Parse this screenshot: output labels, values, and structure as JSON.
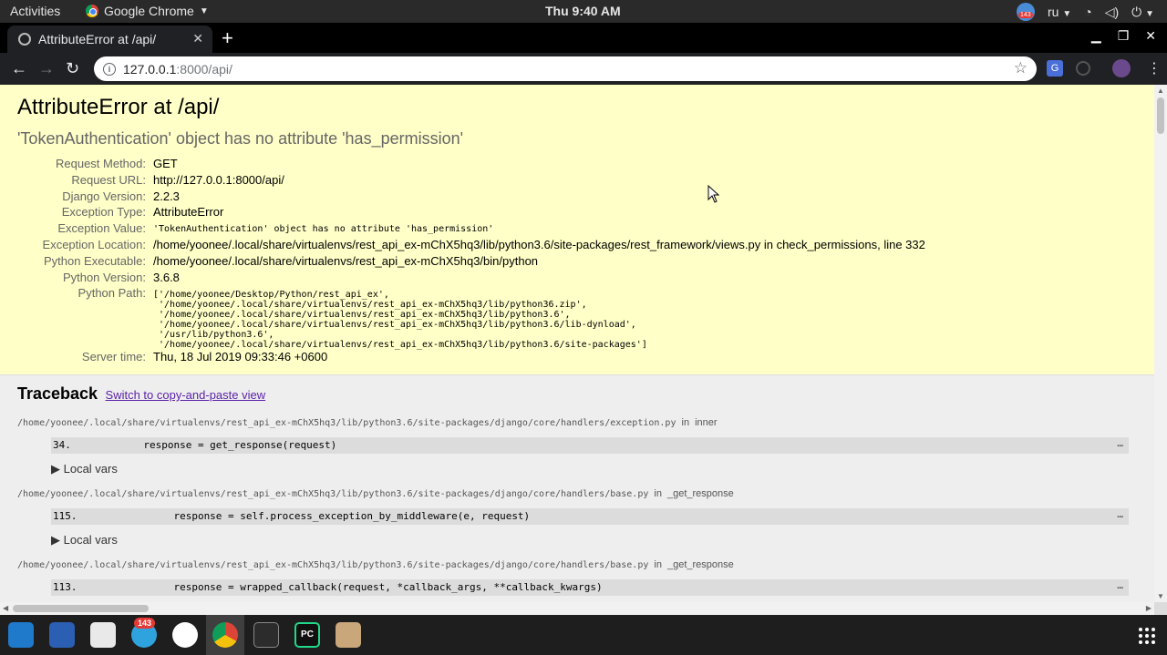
{
  "topbar": {
    "activities": "Activities",
    "app_name": "Google Chrome",
    "clock": "Thu  9:40 AM",
    "lang": "ru",
    "tray_badge": "143"
  },
  "tab": {
    "title": "AttributeError at /api/"
  },
  "omnibox": {
    "host": "127.0.0.1",
    "path": ":8000/api/"
  },
  "extensions": {
    "translate_label": "G"
  },
  "page": {
    "title": "AttributeError at /api/",
    "subtitle": "'TokenAuthentication' object has no attribute 'has_permission'",
    "meta": {
      "request_method": {
        "label": "Request Method:",
        "value": "GET"
      },
      "request_url": {
        "label": "Request URL:",
        "value": "http://127.0.0.1:8000/api/"
      },
      "django_version": {
        "label": "Django Version:",
        "value": "2.2.3"
      },
      "exception_type": {
        "label": "Exception Type:",
        "value": "AttributeError"
      },
      "exception_value": {
        "label": "Exception Value:",
        "value": "'TokenAuthentication' object has no attribute 'has_permission'"
      },
      "exception_location": {
        "label": "Exception Location:",
        "value": "/home/yoonee/.local/share/virtualenvs/rest_api_ex-mChX5hq3/lib/python3.6/site-packages/rest_framework/views.py in check_permissions, line 332"
      },
      "python_executable": {
        "label": "Python Executable:",
        "value": "/home/yoonee/.local/share/virtualenvs/rest_api_ex-mChX5hq3/bin/python"
      },
      "python_version": {
        "label": "Python Version:",
        "value": "3.6.8"
      },
      "python_path": {
        "label": "Python Path:",
        "value": "['/home/yoonee/Desktop/Python/rest_api_ex',\n '/home/yoonee/.local/share/virtualenvs/rest_api_ex-mChX5hq3/lib/python36.zip',\n '/home/yoonee/.local/share/virtualenvs/rest_api_ex-mChX5hq3/lib/python3.6',\n '/home/yoonee/.local/share/virtualenvs/rest_api_ex-mChX5hq3/lib/python3.6/lib-dynload',\n '/usr/lib/python3.6',\n '/home/yoonee/.local/share/virtualenvs/rest_api_ex-mChX5hq3/lib/python3.6/site-packages']"
      },
      "server_time": {
        "label": "Server time:",
        "value": "Thu, 18 Jul 2019 09:33:46 +0600"
      }
    }
  },
  "traceback": {
    "heading": "Traceback",
    "switch_link": "Switch to copy-and-paste view",
    "in_word": "in",
    "ellipsis": "…",
    "local_vars": "▶ Local vars",
    "frames": [
      {
        "file": "/home/yoonee/.local/share/virtualenvs/rest_api_ex-mChX5hq3/lib/python3.6/site-packages/django/core/handlers/exception.py",
        "func": "inner",
        "code": "34.            response = get_response(request)"
      },
      {
        "file": "/home/yoonee/.local/share/virtualenvs/rest_api_ex-mChX5hq3/lib/python3.6/site-packages/django/core/handlers/base.py",
        "func": "_get_response",
        "code": "115.                response = self.process_exception_by_middleware(e, request)"
      },
      {
        "file": "/home/yoonee/.local/share/virtualenvs/rest_api_ex-mChX5hq3/lib/python3.6/site-packages/django/core/handlers/base.py",
        "func": "_get_response",
        "code": "113.                response = wrapped_callback(request, *callback_args, **callback_kwargs)"
      }
    ]
  },
  "dock": {
    "telegram_badge": "143",
    "pycharm_label": "PC"
  }
}
